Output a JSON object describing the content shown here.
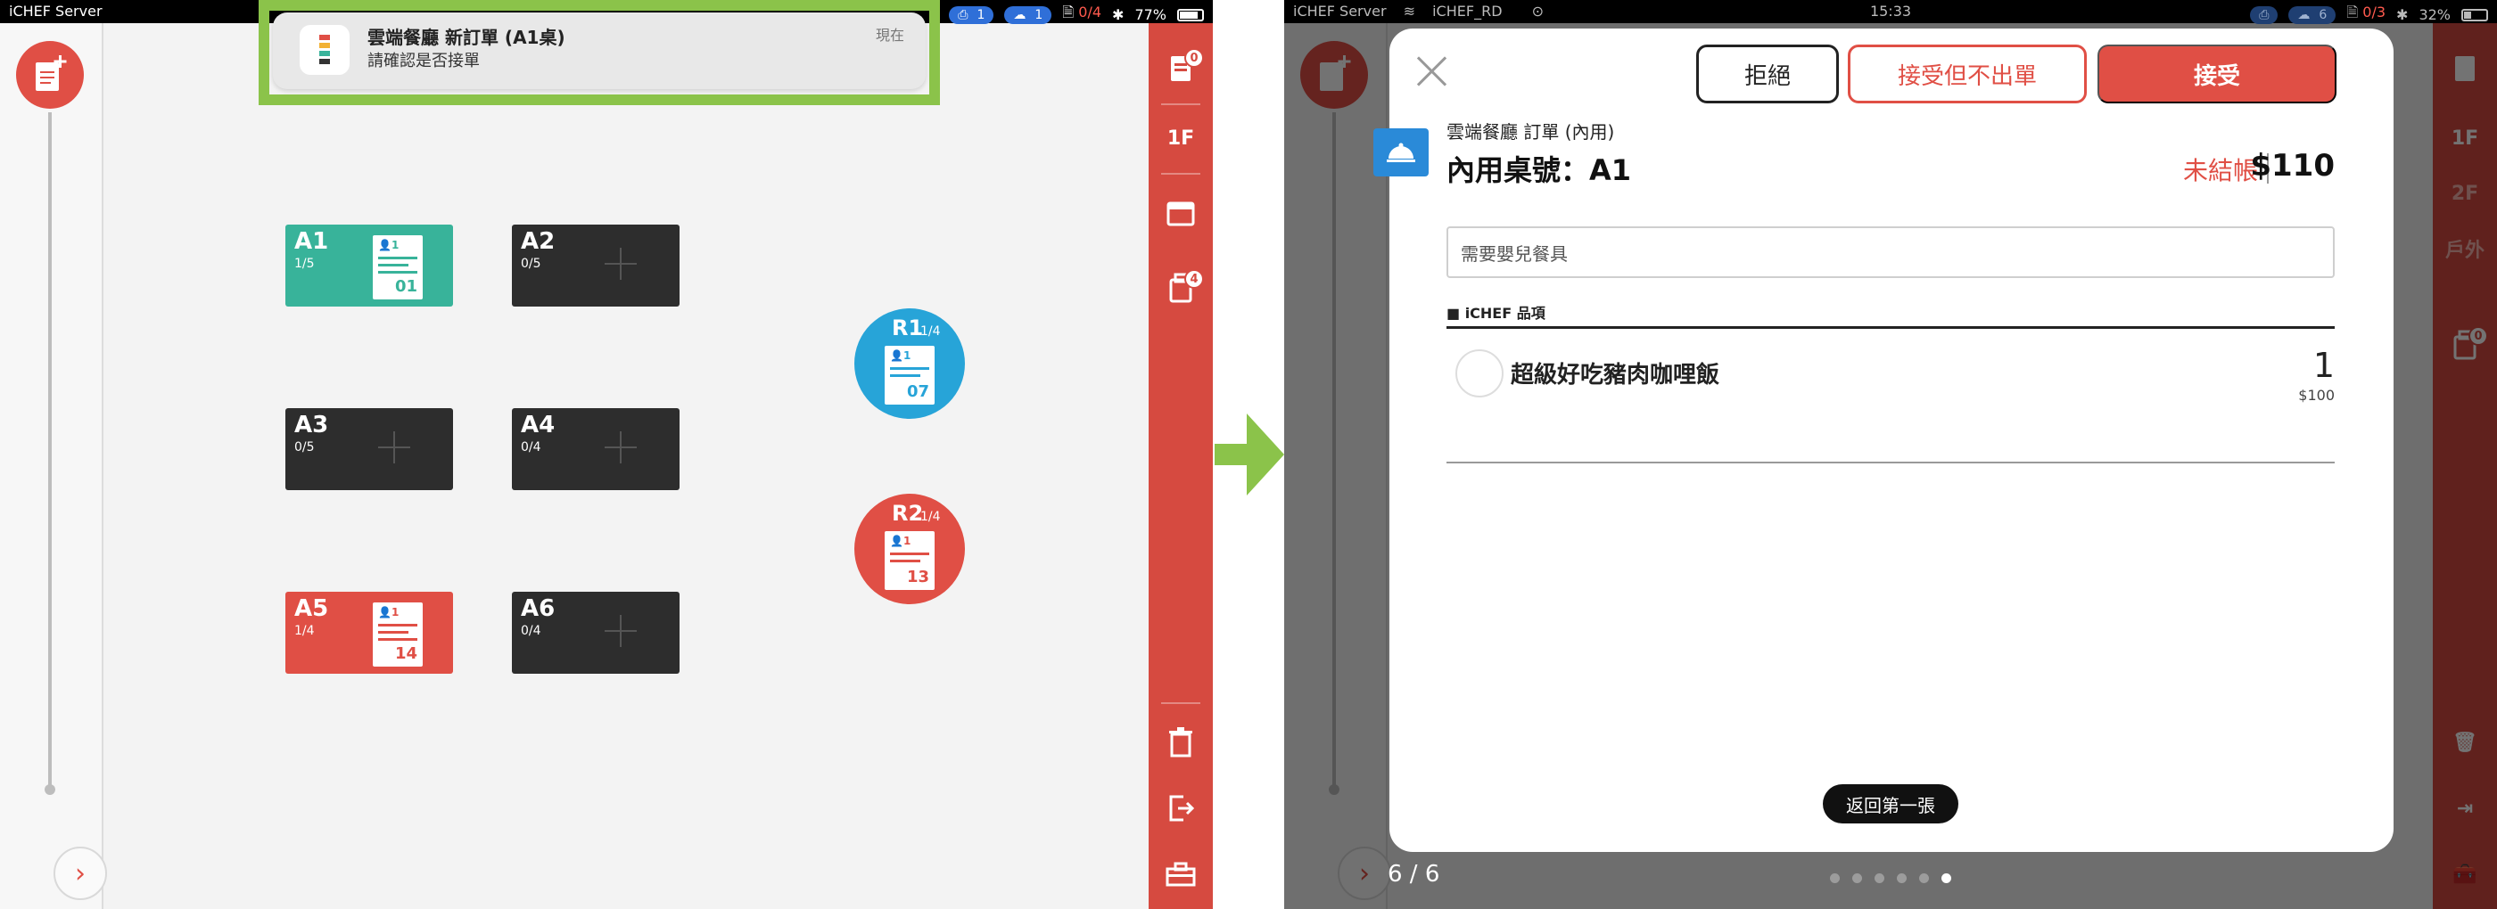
{
  "left": {
    "status": {
      "carrier": "iCHEF Server",
      "pill_print_count": "1",
      "pill_cloud_count": "1",
      "order_count": "0/4",
      "battery": "77%"
    },
    "notification": {
      "title": "雲端餐廳  新訂單 (A1桌)",
      "subtitle": "請確認是否接單",
      "time": "現在"
    },
    "tables": [
      {
        "name": "A1",
        "cap": "1/5",
        "state": "green",
        "guests": "1",
        "ticket": "01"
      },
      {
        "name": "A2",
        "cap": "0/5",
        "state": "empty"
      },
      {
        "name": "A3",
        "cap": "0/5",
        "state": "empty"
      },
      {
        "name": "A4",
        "cap": "0/4",
        "state": "empty"
      },
      {
        "name": "A5",
        "cap": "1/4",
        "state": "red",
        "guests": "1",
        "ticket": "14"
      },
      {
        "name": "A6",
        "cap": "0/4",
        "state": "empty"
      }
    ],
    "round_tables": [
      {
        "name": "R1",
        "cap": "1/4",
        "guests": "1",
        "ticket": "07",
        "color": "blue"
      },
      {
        "name": "R2",
        "cap": "1/4",
        "guests": "1",
        "ticket": "13",
        "color": "red"
      }
    ],
    "sidebar": {
      "printer_badge": "0",
      "floor": "1F",
      "basket_badge": "4"
    }
  },
  "right": {
    "status": {
      "carrier": "iCHEF Server",
      "wifi": "iCHEF_RD",
      "time": "15:33",
      "pill_cloud_count": "6",
      "order_count": "0/3",
      "battery": "32%"
    },
    "sidebar": {
      "floor_1": "1F",
      "floor_2": "2F",
      "floor_3": "戶外",
      "basket_badge": "0"
    },
    "modal": {
      "reject_label": "拒絕",
      "accept_no_print_label": "接受但不出單",
      "accept_label": "接受",
      "order_sub": "雲端餐廳 訂單 (內用)",
      "order_title": "內用桌號：A1",
      "unpaid": "未結帳",
      "total": "$110",
      "note_value": "需要嬰兒餐具",
      "section_label": "■ iCHEF 品項",
      "items": [
        {
          "name": "超級好吃豬肉咖哩飯",
          "qty": "1",
          "price": "$100"
        }
      ],
      "back_first": "返回第一張"
    },
    "pager": "6 / 6",
    "page_dots": 6,
    "active_dot": 6
  },
  "colors": {
    "accent_red": "#e04f45",
    "green_table": "#38b39a",
    "blue_table": "#27a4d8",
    "dark_table": "#2d2d2d",
    "highlight_green": "#8bc34a",
    "dine_in_blue": "#2a8ad8"
  }
}
